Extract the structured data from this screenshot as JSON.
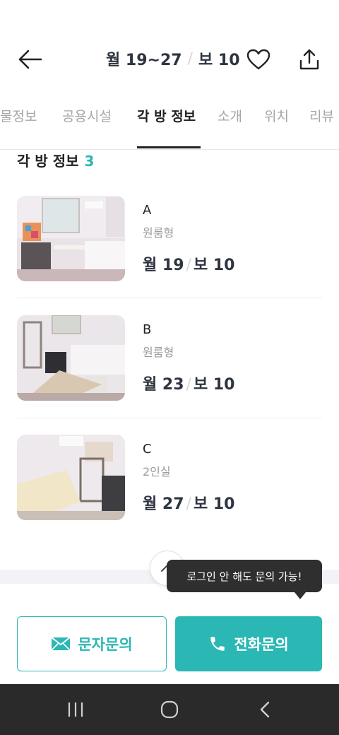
{
  "header": {
    "title_monthly": "월 19~27",
    "title_separator": "/",
    "title_deposit": "보 10"
  },
  "tabs": [
    {
      "label": "물정보",
      "active": false
    },
    {
      "label": "공용시설",
      "active": false
    },
    {
      "label": "각 방 정보",
      "active": true
    },
    {
      "label": "소개",
      "active": false
    },
    {
      "label": "위치",
      "active": false
    },
    {
      "label": "리뷰",
      "active": false
    }
  ],
  "section": {
    "title": "각 방 정보",
    "count": "3"
  },
  "rooms": [
    {
      "name": "A",
      "type": "원룸형",
      "price_monthly": "월 19",
      "separator": "/",
      "price_deposit": "보 10"
    },
    {
      "name": "B",
      "type": "원룸형",
      "price_monthly": "월 23",
      "separator": "/",
      "price_deposit": "보 10"
    },
    {
      "name": "C",
      "type": "2인실",
      "price_monthly": "월 27",
      "separator": "/",
      "price_deposit": "보 10"
    }
  ],
  "tooltip": "로그인 안 해도 문의 가능!",
  "actions": {
    "sms_label": "문자문의",
    "call_label": "전화문의"
  },
  "colors": {
    "accent": "#2bb7b3",
    "navbar": "#2a2a2a",
    "tooltip": "#2f2f2f"
  },
  "icons": [
    "back-arrow-icon",
    "heart-icon",
    "share-icon",
    "chevron-up-icon",
    "mail-icon",
    "phone-icon",
    "recent-apps-icon",
    "home-icon",
    "nav-back-icon"
  ]
}
